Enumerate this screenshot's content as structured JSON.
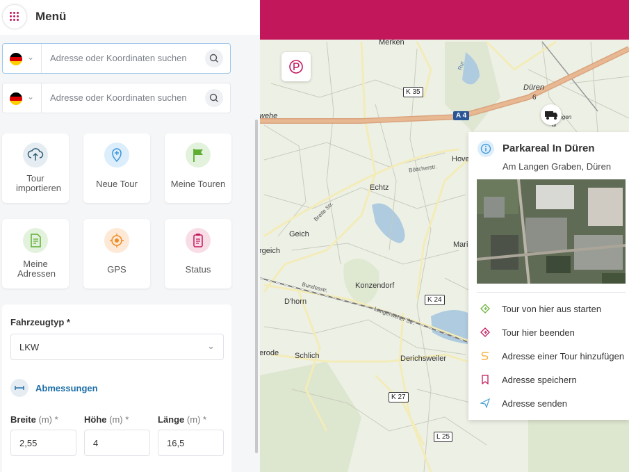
{
  "menu": {
    "title": "Menü"
  },
  "search": [
    {
      "placeholder": "Adresse oder Koordinaten suchen"
    },
    {
      "placeholder": "Adresse oder Koordinaten suchen"
    }
  ],
  "tiles": [
    {
      "label": "Tour importieren",
      "icon": "upload-cloud-icon"
    },
    {
      "label": "Neue Tour",
      "icon": "add-location-icon"
    },
    {
      "label": "Meine Touren",
      "icon": "flag-icon"
    },
    {
      "label": "Meine Adressen",
      "icon": "document-icon"
    },
    {
      "label": "GPS",
      "icon": "gps-target-icon"
    },
    {
      "label": "Status",
      "icon": "clipboard-icon"
    }
  ],
  "form": {
    "vehicle_label": "Fahrzeugtyp *",
    "vehicle_value": "LKW",
    "dimensions_label": "Abmessungen",
    "width_label": "Breite",
    "height_label": "Höhe",
    "length_label": "Länge",
    "unit": "(m) *",
    "width_value": "2,55",
    "height_value": "4",
    "length_value": "16,5"
  },
  "map_labels": {
    "merken": "Merken",
    "dueren": "Düren",
    "dueren_six": "6",
    "hove": "Hove",
    "echtz": "Echtz",
    "geich": "Geich",
    "mari": "Mari",
    "rgeich": "rgeich",
    "konzendorf": "Konzendorf",
    "dhorn": "D'horn",
    "erode": "erode",
    "schlich": "Schlich",
    "derichsweiler": "Derichsweiler",
    "k35": "K 35",
    "a4": "A 4",
    "k24": "K 24",
    "k27": "K 27",
    "l25": "L 25",
    "wehe": "wehe",
    "boettcherstr": "Böttcherstr.",
    "breitestr": "Breite Str.",
    "bundesstr": "Bundesstr.",
    "langerweherstr": "Langerweher Str.",
    "rur": "Rur",
    "gegen": "gegen",
    "al": "al"
  },
  "popup": {
    "title": "Parkareal In Düren",
    "address": "Am Langen Graben, Düren",
    "actions": [
      {
        "label": "Tour von hier aus starten",
        "icon": "start-diamond-icon",
        "color": "#6db33f"
      },
      {
        "label": "Tour hier beenden",
        "icon": "end-diamond-icon",
        "color": "#c2185b"
      },
      {
        "label": "Adresse einer Tour hinzufügen",
        "icon": "route-add-icon",
        "color": "#f5a623"
      },
      {
        "label": "Adresse speichern",
        "icon": "bookmark-icon",
        "color": "#c2185b"
      },
      {
        "label": "Adresse senden",
        "icon": "send-icon",
        "color": "#4a9fd8"
      }
    ]
  },
  "colors": {
    "brand": "#c2185b",
    "accent_blue": "#1e6fa8"
  }
}
